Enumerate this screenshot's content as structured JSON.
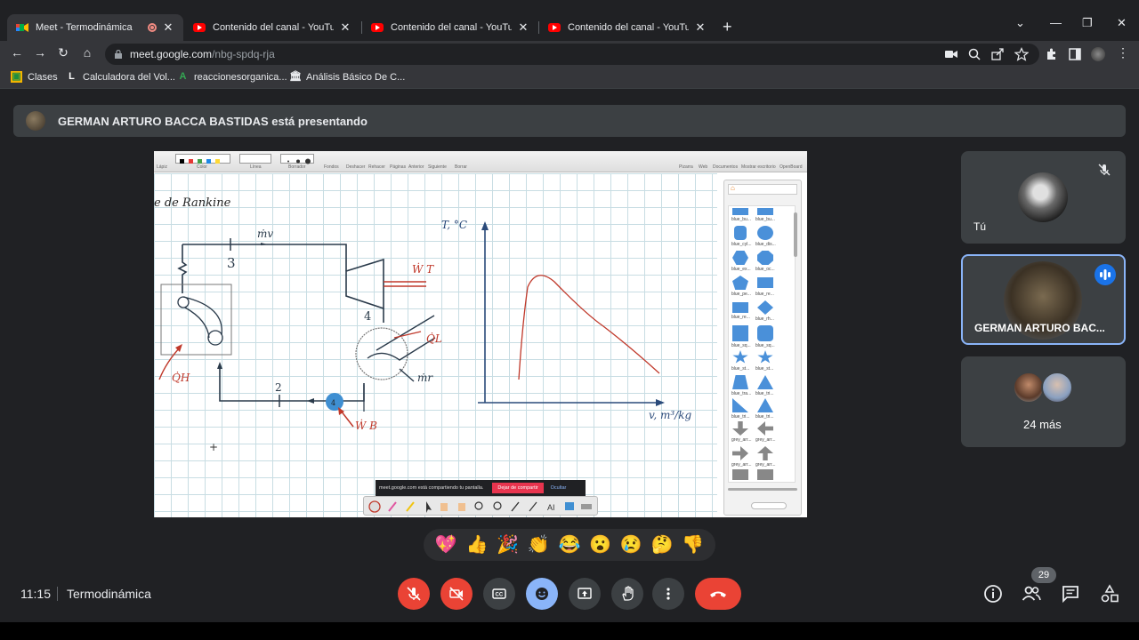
{
  "browser": {
    "tabs": [
      {
        "title": "Meet - Termodinámica",
        "favicon": "google-meet-icon"
      },
      {
        "title": "Contenido del canal - YouTube St",
        "favicon": "youtube-icon"
      },
      {
        "title": "Contenido del canal - YouTube St",
        "favicon": "youtube-icon"
      },
      {
        "title": "Contenido del canal - YouTube St",
        "favicon": "youtube-icon"
      }
    ],
    "url_host": "meet.google.com",
    "url_path": "/nbg-spdq-rja",
    "bookmarks": [
      {
        "label": "Clases",
        "icon": "classroom-icon"
      },
      {
        "label": "Calculadora del Vol...",
        "icon": "L"
      },
      {
        "label": "reaccionesorganica...",
        "icon": "A"
      },
      {
        "label": "Análisis Básico De C...",
        "icon": "bank-icon"
      }
    ]
  },
  "meet": {
    "presenter_banner": "GERMAN ARTURO BACCA BASTIDAS está presentando",
    "shared_screen": {
      "share_notice": "meet.google.com está compartiendo tu pantalla.",
      "stop_label": "Dejar de compartir",
      "hide_label": "Ocultar",
      "whiteboard_labels": {
        "title_fragment": "e de Rankine",
        "m_v": "ṁv",
        "state_3": "3",
        "w_t": "Ẇ T",
        "state_4": "4",
        "q_l": "Q̇L",
        "m_r": "ṁr",
        "q_h": "Q̇H",
        "state_2": "2",
        "pump_4": "4",
        "w_b": "Ẇ B",
        "y_axis": "T, °C",
        "x_axis": "v, m³/kg"
      },
      "toolbar_labels": [
        "Lápiz",
        "Color",
        "Línea",
        "Borrador",
        "Fondos",
        "Deshacer",
        "Rehacer",
        "Páginas",
        "Anterior",
        "Siguiente",
        "Borrar"
      ],
      "toolbar_right_labels": [
        "Pizarra",
        "Web",
        "Documentos",
        "Mostrar escritorio",
        "OpenBoard"
      ],
      "shape_labels": [
        "blue_bu...",
        "blue_bu...",
        "blue_cyl...",
        "blue_dis...",
        "blue_ex...",
        "blue_oc...",
        "blue_pe...",
        "blue_re...",
        "blue_re...",
        "blue_rh...",
        "blue_sq...",
        "blue_sq...",
        "blue_st...",
        "blue_st...",
        "blue_tra...",
        "blue_tri...",
        "blue_tri...",
        "blue_tri...",
        "grey_arr...",
        "grey_arr...",
        "grey_arr...",
        "grey_arr..."
      ]
    },
    "participants": {
      "you_label": "Tú",
      "active_speaker": "GERMAN ARTURO BAC...",
      "more_label": "24 más"
    },
    "reactions": [
      "💖",
      "👍",
      "🎉",
      "👏",
      "😂",
      "😮",
      "😢",
      "🤔",
      "👎"
    ],
    "time": "11:15",
    "meeting_name": "Termodinámica",
    "participant_count": "29"
  }
}
